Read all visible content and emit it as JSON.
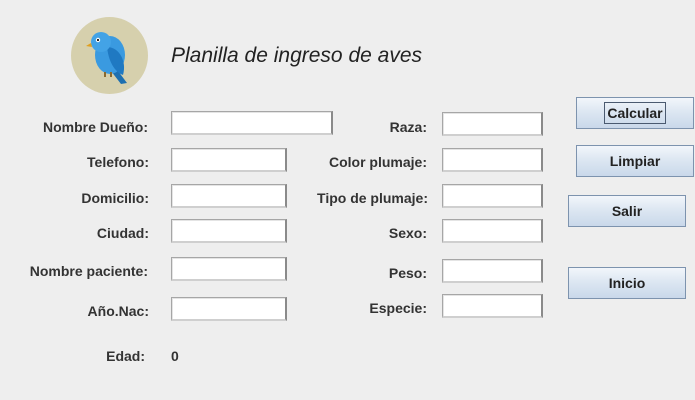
{
  "window": {
    "title": "Planilla de ingreso de aves",
    "logo_icon": "blue-bird-icon"
  },
  "form_left": [
    {
      "label": "Nombre Dueño:",
      "value": ""
    },
    {
      "label": "Telefono:",
      "value": ""
    },
    {
      "label": "Domicilio:",
      "value": ""
    },
    {
      "label": "Ciudad:",
      "value": ""
    },
    {
      "label": "Nombre paciente:",
      "value": ""
    },
    {
      "label": "Año.Nac:",
      "value": ""
    }
  ],
  "form_right": [
    {
      "label": "Raza:",
      "value": ""
    },
    {
      "label": "Color plumaje:",
      "value": ""
    },
    {
      "label": "Tipo de plumaje:",
      "value": ""
    },
    {
      "label": "Sexo:",
      "value": ""
    },
    {
      "label": "Peso:",
      "value": ""
    },
    {
      "label": "Especie:",
      "value": ""
    }
  ],
  "age": {
    "label": "Edad:",
    "value": "0"
  },
  "buttons": {
    "calcular": "Calcular",
    "limpiar": "Limpiar",
    "salir": "Salir",
    "inicio": "Inicio"
  },
  "colors": {
    "background": "#eeeeee",
    "logo_circle": "#d6d0ad",
    "bird_blue": "#2e8fd6",
    "button_top": "#f2f6fb",
    "button_bottom": "#c9d8ea"
  }
}
